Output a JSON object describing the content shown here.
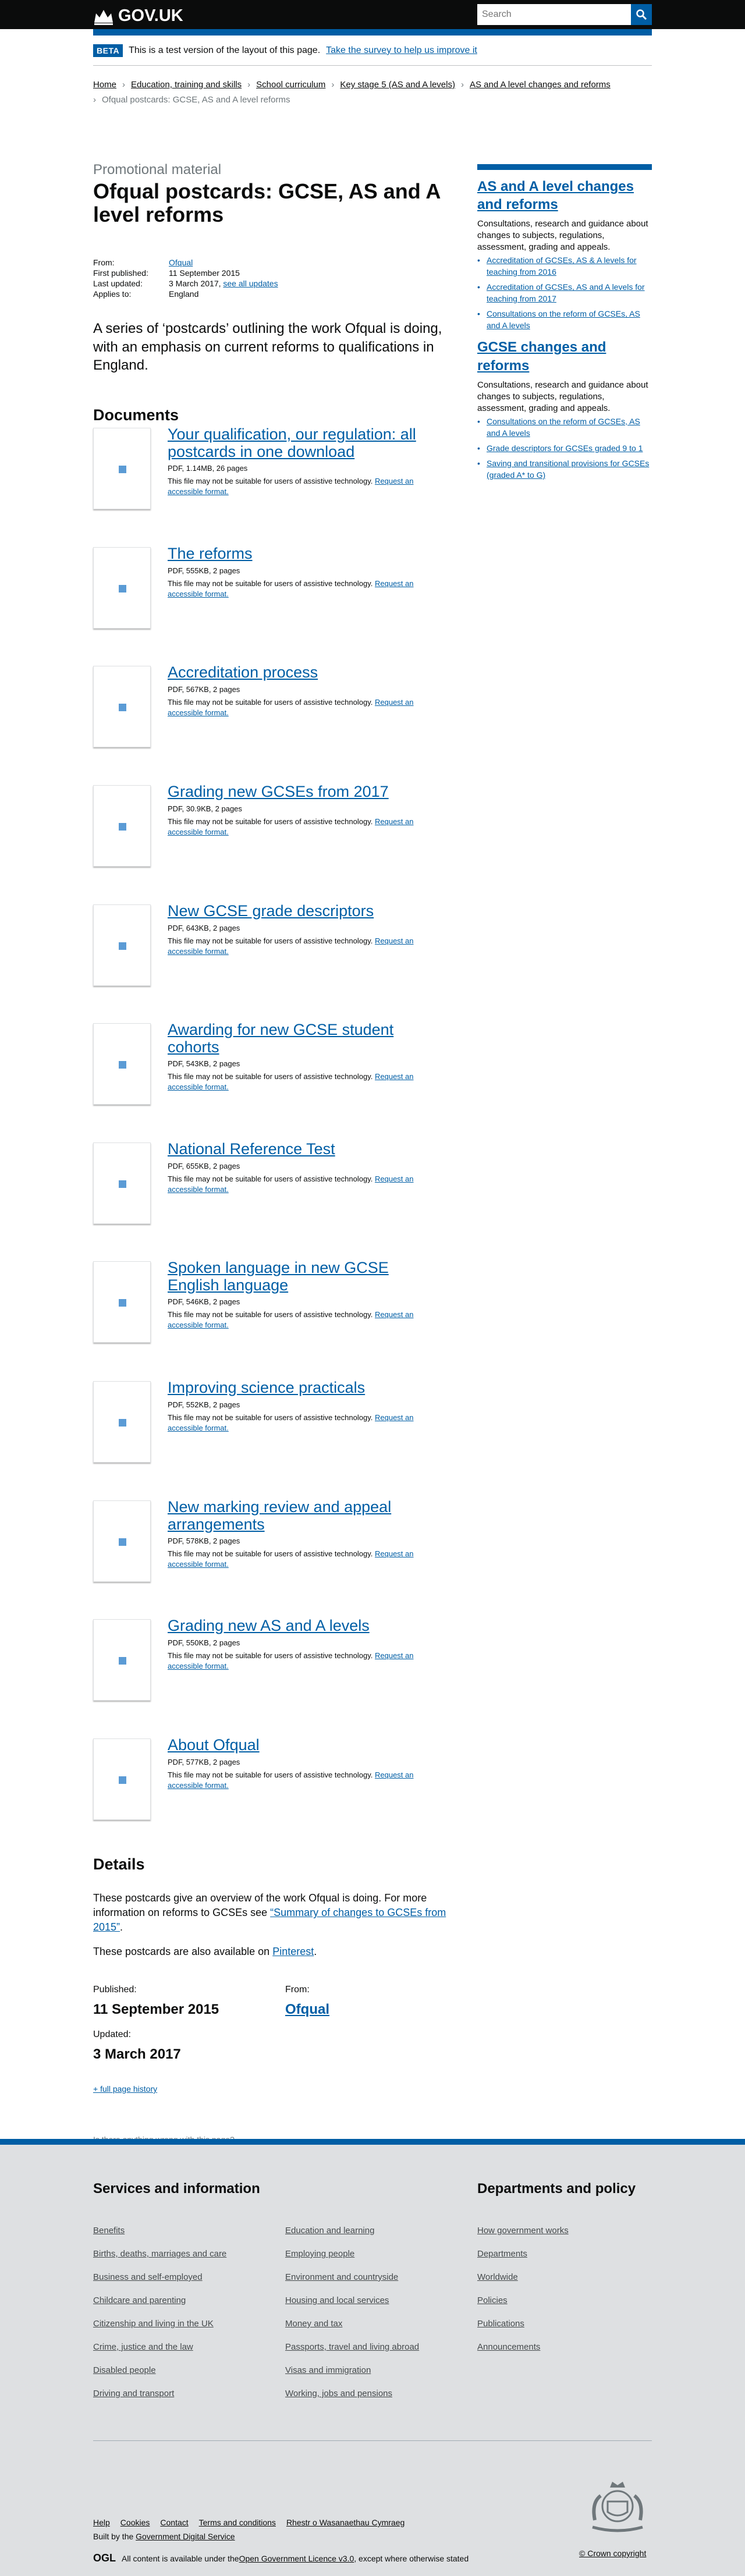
{
  "header": {
    "logo_text": "GOV.UK",
    "search_placeholder": "Search"
  },
  "beta": {
    "tag": "BETA",
    "text": "This is a test version of the layout of this page.",
    "link": "Take the survey to help us improve it"
  },
  "breadcrumbs": [
    "Home",
    "Education, training and skills",
    "School curriculum",
    "Key stage 5 (AS and A levels)",
    "AS and A level changes and reforms",
    "Ofqual postcards: GCSE, AS and A level reforms"
  ],
  "page": {
    "kind": "Promotional material",
    "title": "Ofqual postcards: GCSE, AS and A level reforms",
    "meta": {
      "from_label": "From:",
      "from_value": "Ofqual",
      "first_label": "First published:",
      "first_value": "11 September 2015",
      "updated_label": "Last updated:",
      "updated_value": "3 March 2017,",
      "see_all": "see all updates",
      "applies_label": "Applies to:",
      "applies_value": "England"
    },
    "description": "A series of ‘postcards’ outlining the work Ofqual is doing, with an emphasis on current reforms to qualifications in England.",
    "documents_heading": "Documents",
    "doc_notice": "This file may not be suitable for users of assistive technology.",
    "doc_request": "Request an accessible format.",
    "documents": [
      {
        "title": "Your qualification, our regulation: all postcards in one download",
        "meta": "PDF, 1.14MB, 26 pages"
      },
      {
        "title": "The reforms",
        "meta": "PDF, 555KB, 2 pages"
      },
      {
        "title": "Accreditation process",
        "meta": "PDF, 567KB, 2 pages"
      },
      {
        "title": "Grading new GCSEs from 2017",
        "meta": "PDF, 30.9KB, 2 pages"
      },
      {
        "title": "New GCSE grade descriptors",
        "meta": "PDF, 643KB, 2 pages"
      },
      {
        "title": "Awarding for new GCSE student cohorts",
        "meta": "PDF, 543KB, 2 pages"
      },
      {
        "title": "National Reference Test",
        "meta": "PDF, 655KB, 2 pages"
      },
      {
        "title": "Spoken language in new GCSE English language",
        "meta": "PDF, 546KB, 2 pages"
      },
      {
        "title": "Improving science practicals",
        "meta": "PDF, 552KB, 2 pages"
      },
      {
        "title": "New marking review and appeal arrangements",
        "meta": "PDF, 578KB, 2 pages"
      },
      {
        "title": "Grading new AS and A levels",
        "meta": "PDF, 550KB, 2 pages"
      },
      {
        "title": "About Ofqual",
        "meta": "PDF, 577KB, 2 pages"
      }
    ],
    "details": {
      "heading": "Details",
      "p1_text": "These postcards give an overview of the work Ofqual is doing. For more information on reforms to GCSEs see ",
      "p1_link": "“Summary of changes to GCSEs from 2015”",
      "p1_end": ".",
      "p2_text": "These postcards are also available on ",
      "p2_link": "Pinterest",
      "p2_end": "."
    },
    "published_label": "Published:",
    "published_value": "11 September 2015",
    "from_label": "From:",
    "from_value": "Ofqual",
    "updated_label": "Updated:",
    "updated_value": "3 March 2017",
    "history_link": "+ full page history",
    "report_link": "Is there anything wrong with this page?"
  },
  "sidebar": [
    {
      "heading": "AS and A level changes and reforms",
      "text": "Consultations, research and guidance about changes to subjects, regulations, assessment, grading and appeals.",
      "links": [
        "Accreditation of GCSEs, AS & A levels for teaching from 2016",
        "Accreditation of GCSEs, AS and A levels for teaching from 2017",
        "Consultations on the reform of GCSEs, AS and A levels"
      ]
    },
    {
      "heading": "GCSE changes and reforms",
      "text": "Consultations, research and guidance about changes to subjects, regulations, assessment, grading and appeals.",
      "links": [
        "Consultations on the reform of GCSEs, AS and A levels",
        "Grade descriptors for GCSEs graded 9 to 1",
        "Saving and transitional provisions for GCSEs (graded A* to G)"
      ]
    }
  ],
  "footer": {
    "services_heading": "Services and information",
    "services_col1": [
      "Benefits",
      "Births, deaths, marriages and care",
      "Business and self-employed",
      "Childcare and parenting",
      "Citizenship and living in the UK",
      "Crime, justice and the law",
      "Disabled people",
      "Driving and transport"
    ],
    "services_col2": [
      "Education and learning",
      "Employing people",
      "Environment and countryside",
      "Housing and local services",
      "Money and tax",
      "Passports, travel and living abroad",
      "Visas and immigration",
      "Working, jobs and pensions"
    ],
    "dept_heading": "Departments and policy",
    "dept_links": [
      "How government works",
      "Departments",
      "Worldwide",
      "Policies",
      "Publications",
      "Announcements"
    ],
    "bottom_links": [
      "Help",
      "Cookies",
      "Contact",
      "Terms and conditions",
      "Rhestr o Wasanaethau Cymraeg"
    ],
    "built_by": "Built by the ",
    "built_by_link": "Government Digital Service",
    "ogl": "OGL",
    "licence_pre": "All content is available under the ",
    "licence_link": "Open Government Licence v3.0",
    "licence_post": ", except where otherwise stated",
    "copyright": "© Crown copyright"
  }
}
